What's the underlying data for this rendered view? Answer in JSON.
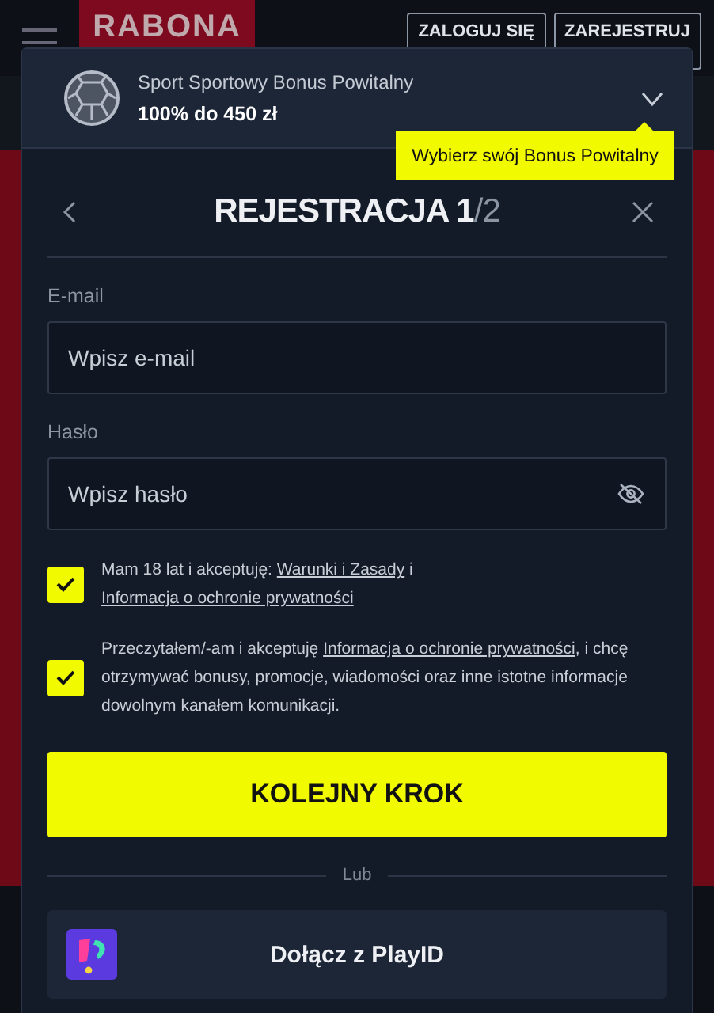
{
  "header": {
    "logo": "RABONA",
    "buttons": [
      "ZALOGUJ SIĘ",
      "ZAREJESTRUJ"
    ]
  },
  "bonus": {
    "category": "Sport Sportowy Bonus Powitalny",
    "amount": "100% do 450 zł",
    "expanded": false,
    "tooltip": "Wybierz swój Bonus Powitalny"
  },
  "title": {
    "text": "REJESTRACJA 1",
    "step_total": "/2"
  },
  "fields": [
    {
      "kind": "email",
      "label": "E-mail",
      "placeholder": "Wpisz e-mail"
    },
    {
      "kind": "password",
      "label": "Hasło",
      "placeholder": "Wpisz hasło"
    }
  ],
  "consents": [
    {
      "checked": true,
      "parts": [
        {
          "kind": "text",
          "text": "Mam 18 lat i akceptuję: "
        },
        {
          "kind": "link",
          "text": "Warunki i Zasady"
        },
        {
          "kind": "text",
          "text": " i "
        },
        {
          "kind": "link",
          "text": "Informacja o ochronie prywatności"
        }
      ]
    },
    {
      "checked": true,
      "parts": [
        {
          "kind": "text",
          "text": "Przeczytałem/-am i akceptuję "
        },
        {
          "kind": "link",
          "text": "Informacja o ochronie prywatności"
        },
        {
          "kind": "text",
          "text": ", i chcę otrzymywać bonusy, promocje, wiadomości oraz inne istotne informacje dowolnym kanałem komunikacji."
        }
      ]
    }
  ],
  "submit": "KOLEJNY KROK",
  "separator": "Lub",
  "social": {
    "label": "Dołącz z PlayID"
  }
}
